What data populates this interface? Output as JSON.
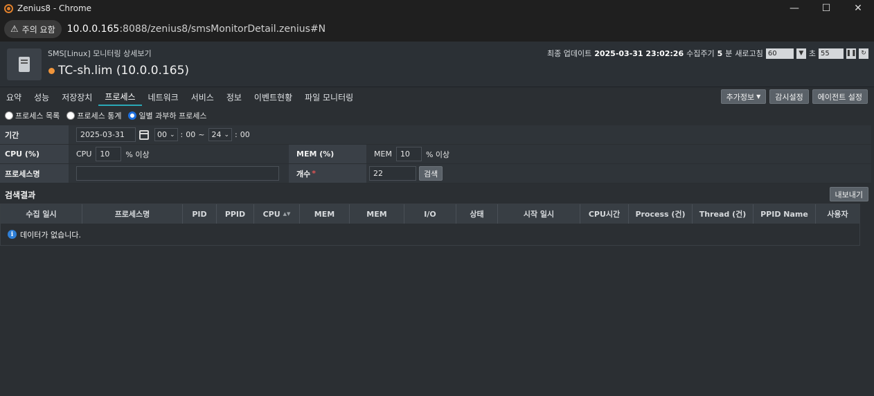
{
  "window": {
    "title": "Zenius8 - Chrome",
    "minimize": "—",
    "maximize": "☐",
    "close": "✕"
  },
  "addressbar": {
    "security_label": "주의 요함",
    "url_host": "10.0.0.165",
    "url_rest": ":8088/zenius8/smsMonitorDetail.zenius#N"
  },
  "header": {
    "subtitle": "SMS[Linux] 모니터링 상세보기",
    "hostname": "TC-sh.lim (10.0.0.165)",
    "status_color": "#f0953b",
    "last_update_label": "최종 업데이트",
    "last_update_value": "2025-03-31 23:02:26",
    "collect_label": "수집주기",
    "collect_value": "5",
    "collect_unit": "분",
    "refresh_label": "새로고침",
    "refresh_value": "60",
    "seconds_label": "초",
    "seconds_value": "55"
  },
  "tabs": [
    {
      "label": "요약"
    },
    {
      "label": "성능"
    },
    {
      "label": "저장장치"
    },
    {
      "label": "프로세스",
      "active": true
    },
    {
      "label": "네트워크"
    },
    {
      "label": "서비스"
    },
    {
      "label": "정보"
    },
    {
      "label": "이벤트현황"
    },
    {
      "label": "파일 모니터링"
    }
  ],
  "tab_actions": {
    "extra_info": "추가정보",
    "monitor_settings": "감시설정",
    "agent_settings": "에이전트 설정"
  },
  "radios": [
    {
      "label": "프로세스 목록",
      "checked": false
    },
    {
      "label": "프로세스 통계",
      "checked": false
    },
    {
      "label": "일별 과부하 프로세스",
      "checked": true
    }
  ],
  "form": {
    "period_label": "기간",
    "date_value": "2025-03-31",
    "hour_from": "00",
    "min_from": "00",
    "tilde": "~",
    "hour_to": "24",
    "min_to": "00",
    "colon": ":",
    "cpu_label": "CPU (%)",
    "cpu_prefix": "CPU",
    "cpu_value": "10",
    "cpu_suffix": "% 이상",
    "mem_label": "MEM (%)",
    "mem_prefix": "MEM",
    "mem_value": "10",
    "mem_suffix": "% 이상",
    "process_label": "프로세스명",
    "count_label": "개수",
    "count_value": "22",
    "search_button": "검색"
  },
  "results": {
    "title": "검색결과",
    "export_button": "내보내기",
    "columns": [
      "수집 일시",
      "프로세스명",
      "PID",
      "PPID",
      "CPU",
      "MEM",
      "MEM",
      "I/O",
      "상태",
      "시작 일시",
      "CPU시간",
      "Process (건)",
      "Thread (건)",
      "PPID Name",
      "사용자"
    ],
    "empty_message": "데이터가 없습니다."
  }
}
